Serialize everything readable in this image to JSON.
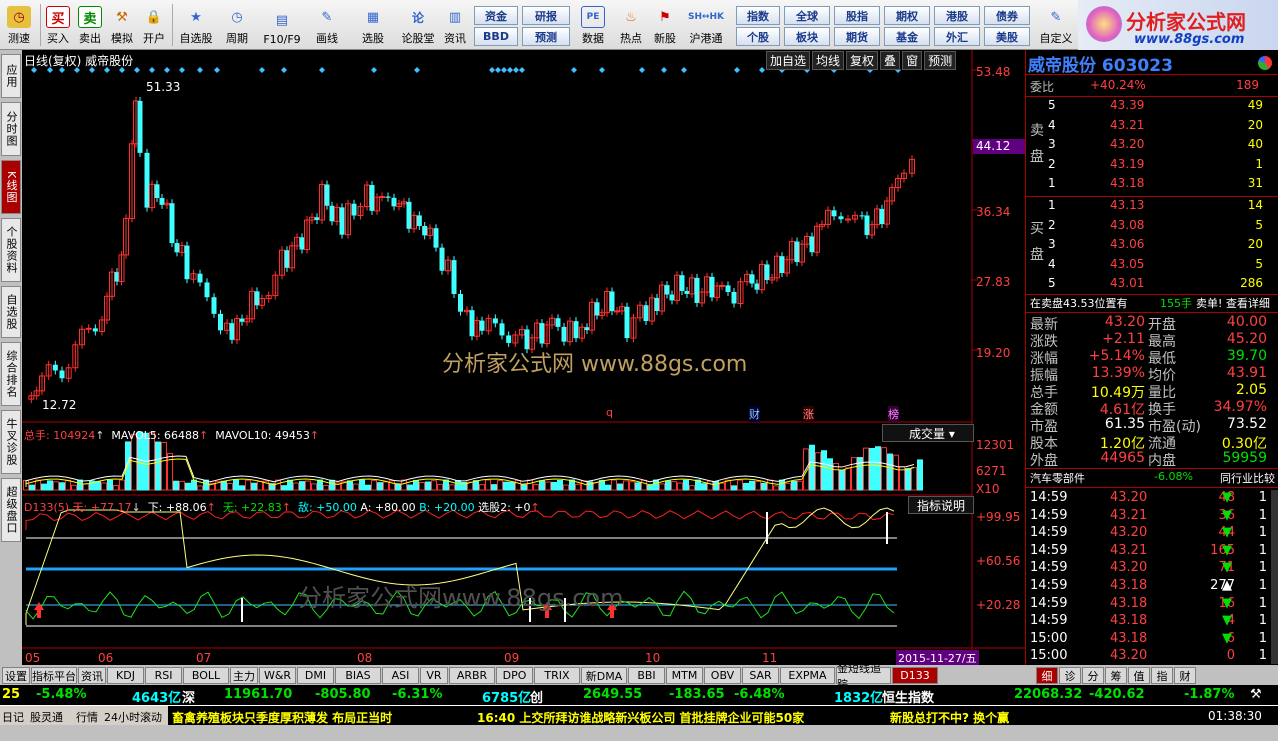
{
  "toolbar": {
    "buttons": [
      "测速",
      "买入",
      "卖出",
      "模拟",
      "开户",
      "自选股",
      "周期",
      "F10/F9",
      "画线",
      "选股",
      "论股堂",
      "资讯",
      "数据",
      "热点",
      "新股",
      "沪港通",
      "自定义"
    ],
    "grid1": [
      "资金",
      "BBD",
      "研报",
      "预测"
    ],
    "grid2": [
      "指数",
      "个股",
      "全球",
      "板块",
      "股指",
      "期货",
      "期权",
      "基金",
      "港股",
      "外汇",
      "债券",
      "美股"
    ]
  },
  "logo": {
    "text": "分析家公式网",
    "url": "www.88gs.com"
  },
  "lefttabs": [
    "应用",
    "分时图",
    "K线图",
    "个股资料",
    "自选股",
    "综合排名",
    "牛叉诊股",
    "超级盘口"
  ],
  "chart": {
    "header": "日线(复权)  威帝股份",
    "menu": [
      "加自选",
      "均线",
      "复权",
      "叠",
      "窗",
      "预测"
    ],
    "price_labels": [
      "53.48",
      "44.12",
      "36.34",
      "27.83",
      "19.20"
    ],
    "hi_label": "51.33",
    "lo_label": "12.72",
    "cursor_price": "44.12",
    "markers": [
      "q",
      "财",
      "涨",
      "榜"
    ],
    "vol_header": {
      "a": "总手: 104924",
      "b": "MAVOL5: 66488",
      "c": "MAVOL10: 49453"
    },
    "vol_btn": "成交量",
    "vol_labels": [
      "12301",
      "6271",
      "X10"
    ],
    "ind_header": {
      "a": "D133(5) 天: +77.17",
      "b": "下: +88.06",
      "c": "无: +22.83",
      "d": "敌: +50.00",
      "e": "A: +80.00",
      "f": "B: +20.00",
      "g": "选股2: +0"
    },
    "ind_btn": "指标说明",
    "ind_labels": [
      "+99.95",
      "+60.56",
      "+20.28"
    ],
    "watermark1": "分析家公式网  www.88gs.com",
    "watermark2": "分析家公式网www.88gs.com",
    "months": [
      "05",
      "06",
      "07",
      "08",
      "09",
      "10",
      "11"
    ],
    "date": "2015-11-27/五"
  },
  "quote": {
    "name": "威帝股份",
    "code": "603023",
    "wb_label": "委比",
    "wb": "+40.24%",
    "wb_n": "189",
    "asks": [
      [
        "5",
        "43.39",
        "49"
      ],
      [
        "4",
        "43.21",
        "20"
      ],
      [
        "3",
        "43.20",
        "40"
      ],
      [
        "2",
        "43.19",
        "1"
      ],
      [
        "1",
        "43.18",
        "31"
      ]
    ],
    "bids": [
      [
        "1",
        "43.13",
        "14"
      ],
      [
        "2",
        "43.08",
        "5"
      ],
      [
        "3",
        "43.06",
        "20"
      ],
      [
        "4",
        "43.05",
        "5"
      ],
      [
        "5",
        "43.01",
        "286"
      ]
    ],
    "sell_side": "卖盘",
    "buy_side": "买盘",
    "info": "在卖盘43.53位置有",
    "info_n": "155手",
    "info_b": "卖单! 查看详细",
    "stats": [
      [
        "最新",
        "43.20",
        "开盘",
        "40.00"
      ],
      [
        "涨跌",
        "+2.11",
        "最高",
        "45.20"
      ],
      [
        "涨幅",
        "+5.14%",
        "最低",
        "39.70"
      ],
      [
        "振幅",
        "13.39%",
        "均价",
        "43.91"
      ],
      [
        "总手",
        "10.49万",
        "量比",
        "2.05"
      ],
      [
        "金额",
        "4.61亿",
        "换手",
        "34.97%"
      ],
      [
        "市盈",
        "61.35",
        "市盈(动)",
        "73.52"
      ],
      [
        "股本",
        "1.20亿",
        "流通",
        "0.30亿"
      ],
      [
        "外盘",
        "44965",
        "内盘",
        "59959"
      ]
    ],
    "industry": "汽车零部件",
    "ind_chg": "-6.08%",
    "ind_cmp": "同行业比较",
    "ticks": [
      [
        "14:59",
        "43.20",
        "48",
        "down"
      ],
      [
        "14:59",
        "43.21",
        "36",
        "down"
      ],
      [
        "14:59",
        "43.20",
        "44",
        "down"
      ],
      [
        "14:59",
        "43.21",
        "165",
        "down"
      ],
      [
        "14:59",
        "43.20",
        "71",
        "down"
      ],
      [
        "14:59",
        "43.18",
        "277",
        "up"
      ],
      [
        "14:59",
        "43.18",
        "16",
        "down"
      ],
      [
        "14:59",
        "43.18",
        "4",
        "down"
      ],
      [
        "15:00",
        "43.18",
        "6",
        "down"
      ],
      [
        "15:00",
        "43.20",
        "0",
        ""
      ]
    ],
    "tick_tail": "1"
  },
  "bottomtabs": [
    "设置",
    "指标平台",
    "资讯",
    "KDJ",
    "RSI",
    "BOLL",
    "主力",
    "W&R",
    "DMI",
    "BIAS",
    "ASI",
    "VR",
    "ARBR",
    "DPO",
    "TRIX",
    "新DMA",
    "BBI",
    "MTM",
    "OBV",
    "SAR",
    "EXPMA",
    "金短线追踪",
    "D133"
  ],
  "righttabs": [
    "细",
    "诊",
    "分",
    "筹",
    "值",
    "指",
    "财"
  ],
  "ticker": {
    "a": "25",
    "b": "-5.48%",
    "c": "4643亿",
    "d": "深",
    "e": "11961.70",
    "f": "-805.80",
    "g": "-6.31%",
    "h": "6785亿",
    "i": "创",
    "j": "2649.55",
    "k": "-183.65",
    "l": "-6.48%",
    "m": "1832亿",
    "n": "恒生指数",
    "o": "22068.32",
    "p": "-420.62",
    "q": "-1.87%"
  },
  "status": {
    "tabs": [
      "日记",
      "股灵通",
      "行情",
      "24小时滚动"
    ],
    "n1": "畜禽养殖板块只季度厚积薄发 布局正当时",
    "n2": "16:40 上交所拜访谁战略新兴板公司 首批挂牌企业可能50家",
    "n3": "新股总打不中? 换个赢",
    "time": "01:38:30"
  }
}
